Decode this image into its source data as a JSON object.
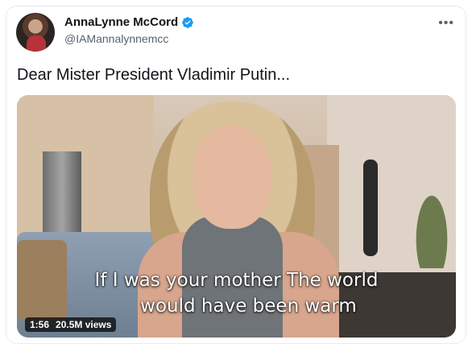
{
  "author": {
    "display_name": "AnnaLynne McCord",
    "handle": "@IAMannalynnemcc",
    "verified_icon": "verified-badge-icon",
    "avatar_icon": "avatar"
  },
  "menu": {
    "more_label": "•••"
  },
  "tweet": {
    "text": "Dear Mister President Vladimir Putin..."
  },
  "video": {
    "caption_line1": "If I was your mother The world",
    "caption_line2": "would have been warm",
    "duration": "1:56",
    "views": "20.5M views"
  },
  "colors": {
    "verified_blue": "#1d9bf0",
    "text_primary": "#0f1419",
    "text_secondary": "#536471"
  }
}
